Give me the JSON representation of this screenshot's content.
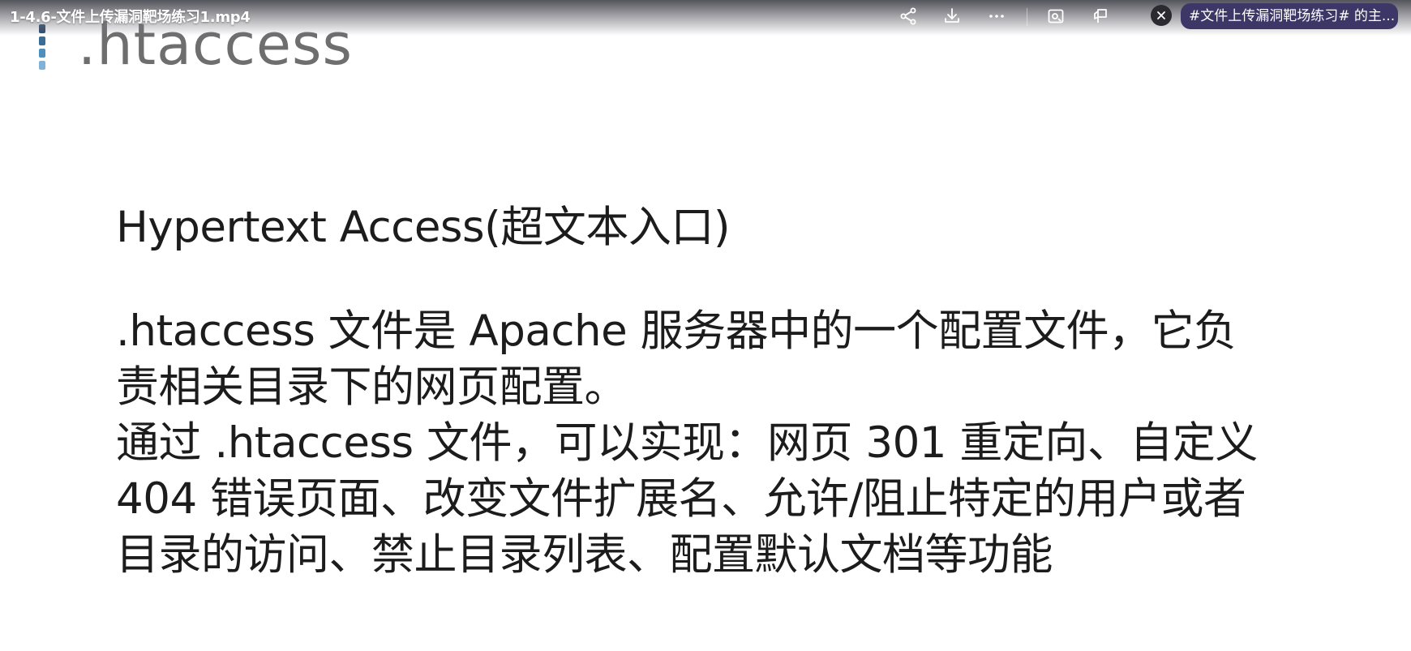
{
  "player": {
    "title": "1-4.6-文件上传漏洞靶场练习1.mp4",
    "toolbar": {
      "share_icon": "share-icon",
      "download_icon": "download-icon",
      "more_icon": "more-icon",
      "screenshot_icon": "screenshot-icon",
      "pin_icon": "pin-icon",
      "close_icon": "close-icon"
    },
    "topic_tag": "#文件上传漏洞靶场练习# 的主..."
  },
  "slide": {
    "heading": ".htaccess",
    "marker_colors": [
      "#2d4b6b",
      "#3a6d96",
      "#4f8fbf",
      "#7fb3d9"
    ],
    "subtitle": "Hypertext Access(超文本入口)",
    "body_lines": [
      ".htaccess 文件是 Apache 服务器中的一个配置文件，它负",
      "责相关目录下的网页配置。",
      "通过 .htaccess 文件，可以实现：网页 301 重定向、自定义",
      "404 错误页面、改变文件扩展名、允许/阻止特定的用户或者",
      "目录的访问、禁止目录列表、配置默认文档等功能"
    ]
  }
}
